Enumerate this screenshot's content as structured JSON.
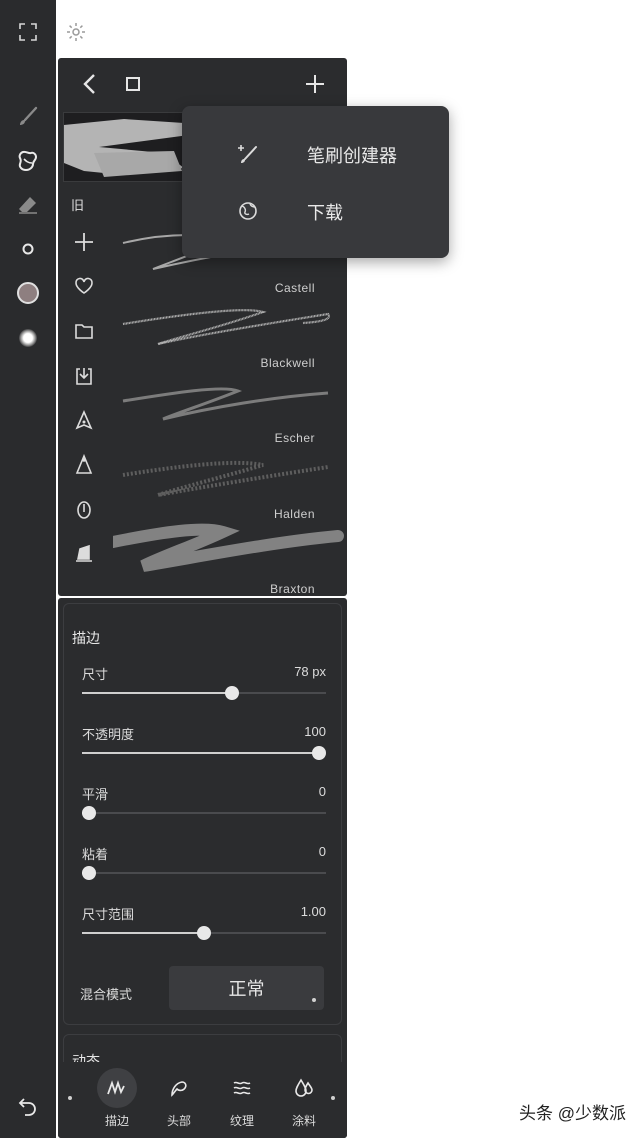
{
  "toolbar_icons": [
    "expand-icon",
    "brush-icon",
    "smudge-icon",
    "eraser-icon",
    "size-dot-icon",
    "color-swatch",
    "opacity-dot-icon",
    "undo-icon"
  ],
  "colors": {
    "swatch": "#8e7f80",
    "panel": "#2b2c2e",
    "popup": "#38393c"
  },
  "library": {
    "old_label": "旧",
    "brushes": [
      {
        "name": "Castell"
      },
      {
        "name": "Blackwell"
      },
      {
        "name": "Escher"
      },
      {
        "name": "Halden"
      },
      {
        "name": "Braxton"
      }
    ]
  },
  "popup": {
    "items": [
      {
        "label": "笔刷创建器",
        "icon": "magic-brush-icon"
      },
      {
        "label": "下载",
        "icon": "download-globe-icon"
      }
    ]
  },
  "stroke": {
    "title": "描边",
    "sliders": [
      {
        "label": "尺寸",
        "value": "78 px",
        "level": 0.62
      },
      {
        "label": "不透明度",
        "value": "100",
        "level": 1.0
      },
      {
        "label": "平滑",
        "value": "0",
        "level": 0.0
      },
      {
        "label": "粘着",
        "value": "0",
        "level": 0.0
      },
      {
        "label": "尺寸范围",
        "value": "1.00",
        "level": 0.5
      }
    ],
    "blend_label": "混合模式",
    "blend_value": "正常"
  },
  "dynamics_title": "动态",
  "tabs": [
    {
      "label": "描边",
      "active": true
    },
    {
      "label": "头部",
      "active": false
    },
    {
      "label": "纹理",
      "active": false
    },
    {
      "label": "涂料",
      "active": false
    }
  ],
  "watermark": "头条 @少数派"
}
